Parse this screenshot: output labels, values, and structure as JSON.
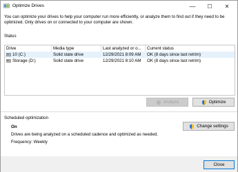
{
  "window": {
    "title": "Optimize Drives",
    "minimize_glyph": "—",
    "maximize_glyph": "☐",
    "close_glyph": "✕"
  },
  "intro": "You can optimize your drives to help your computer run more efficiently, or analyze them to find out if they need to be optimized. Only drives on or connected to your computer are shown.",
  "status": {
    "label": "Status",
    "columns": {
      "drive": "Drive",
      "media_type": "Media type",
      "last_analyzed": "Last analyzed or o...",
      "current_status": "Current status"
    },
    "rows": [
      {
        "drive": "10 (C:)",
        "media_type": "Solid state drive",
        "last_analyzed": "12/29/2021 8:09 AM",
        "current_status": "OK (8 days since last retrim)",
        "selected": true
      },
      {
        "drive": "Storage (D:)",
        "media_type": "Solid state drive",
        "last_analyzed": "12/29/2021 8:10 AM",
        "current_status": "OK (8 days since last retrim)",
        "selected": false
      }
    ],
    "analyze_label": "Analyze",
    "optimize_label": "Optimize"
  },
  "scheduled": {
    "label": "Scheduled optimization",
    "state": "On",
    "description": "Drives are being analyzed on a scheduled cadence and optimized as needed.",
    "frequency": "Frequency: Weekly",
    "change_settings_label": "Change settings"
  },
  "footer": {
    "close_label": "Close"
  },
  "colors": {
    "accent": "#0078d7",
    "selected_row": "#e5f1fb"
  }
}
